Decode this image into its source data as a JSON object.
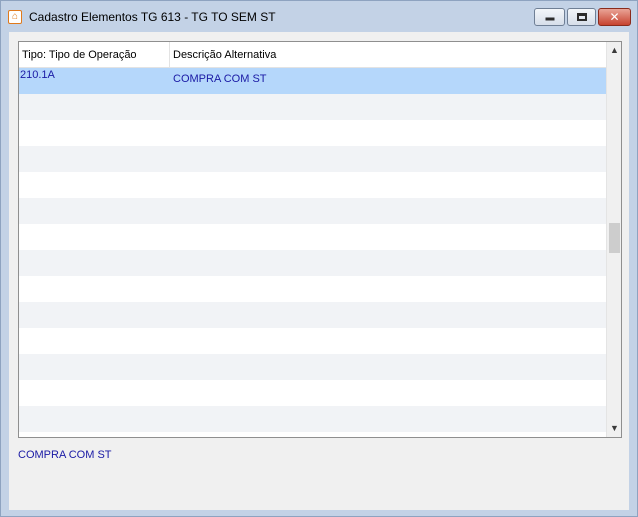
{
  "window": {
    "title": "Cadastro Elementos TG 613 - TG TO SEM ST",
    "close_glyph": "✕"
  },
  "grid": {
    "columns": [
      "Tipo: Tipo de Operação",
      "Descrição Alternativa"
    ],
    "rows": [
      {
        "tipo": "210.1A",
        "descricao": "COMPRA COM ST",
        "selected": true
      }
    ],
    "selection_color": "#b5d7fb",
    "alt_row_color": "#f1f3f6",
    "text_color": "#1a1aa5"
  },
  "scrollbar": {
    "up_glyph": "▲",
    "down_glyph": "▼"
  },
  "detail": {
    "text": "COMPRA COM ST"
  },
  "icons": {
    "app": "app-logo-icon",
    "minimize": "minimize-icon",
    "maximize": "maximize-icon",
    "close": "close-icon",
    "scroll_up": "chevron-up-icon",
    "scroll_down": "chevron-down-icon"
  }
}
